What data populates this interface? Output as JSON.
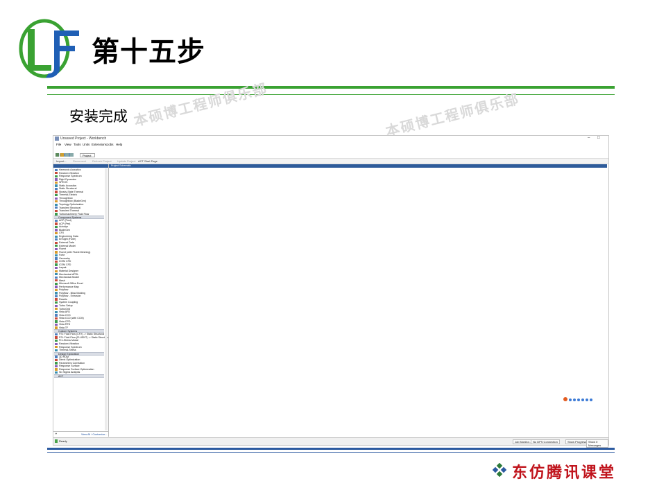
{
  "slide": {
    "title": "第十五步",
    "subtitle": "安装完成",
    "watermark": "本硕博工程师俱乐部",
    "brand": "东仿腾讯课堂",
    "colors": {
      "green_rule": "#3aa232",
      "blue_rule": "#2c5aa0",
      "brand_red": "#c0141c",
      "logo_green": "#3aa232",
      "logo_blue": "#1f5fb5"
    }
  },
  "app": {
    "window_title": "Unsaved Project - Workbench",
    "window_buttons": [
      "–",
      "□"
    ],
    "menu": [
      "File",
      "View",
      "Tools",
      "Units",
      "Extensions",
      "Jobs",
      "Help"
    ],
    "tab_label": "Project",
    "toolbar": {
      "import": "Import...",
      "reconnect": "Reconnect",
      "refresh": "Refresh Project",
      "update": "Update Project",
      "act_start": "ACT Start Page"
    },
    "schematic_title": "Project Schematic",
    "toolbox_footer": "View All / Customize...",
    "status": {
      "ready": "Ready",
      "job_monitor": "Job Monitor...",
      "dps": "No DPS Connection",
      "progress": "Show Progress",
      "messages": "Show 0 Messages"
    },
    "toolbox": {
      "analysis_systems": [
        "Harmonic Acoustics",
        "Random Vibration",
        "Response Spectrum",
        "Rigid Dynamics",
        "SPEOS",
        "Static Acoustics",
        "Static Structural",
        "Steady-State Thermal",
        "Thermal-Electric",
        "Throughflow",
        "Throughflow (BladeGen)",
        "Topology Optimization",
        "Transient Structural",
        "Transient Thermal",
        "Turbomachinery Fluid Flow"
      ],
      "component_header": "Component Systems",
      "component_systems": [
        "ACP (Post)",
        "ACP (Pre)",
        "Autodyn",
        "BladeGen",
        "CFX",
        "Engineering Data",
        "EnSight (Forte)",
        "External Data",
        "External Model",
        "Fluent",
        "Fluent (with Fluent Meshing)",
        "Forte",
        "Geometry",
        "ICEM CFD",
        "ICEM CFD",
        "Icepak",
        "Material Designer",
        "Mechanical APDL",
        "Mechanical Model",
        "Mesh",
        "Microsoft Office Excel",
        "Performance Map",
        "Polyflow",
        "Polyflow - Blow Molding",
        "Polyflow - Extrusion",
        "Results",
        "System Coupling",
        "Turbo Setup",
        "TurboGrid",
        "Vista AFD",
        "Vista CCD",
        "Vista CCD (with CCM)",
        "Vista CPD",
        "Vista RTD",
        "Vista TF"
      ],
      "custom_header": "Custom Systems",
      "custom_systems": [
        "FSI: Fluid Flow (CFX) -> Static Structural",
        "FSI: Fluid Flow (FLUENT) -> Static Structural",
        "Pre-Stress Modal",
        "Random Vibration",
        "Response Spectrum",
        "Thermal-Stress"
      ],
      "design_header": "Design Exploration",
      "design_exploration": [
        "3D ROM",
        "Direct Optimization",
        "Parameters Correlation",
        "Response Surface",
        "Response Surface Optimization",
        "Six Sigma Analysis"
      ],
      "act_header": "ACT"
    }
  }
}
